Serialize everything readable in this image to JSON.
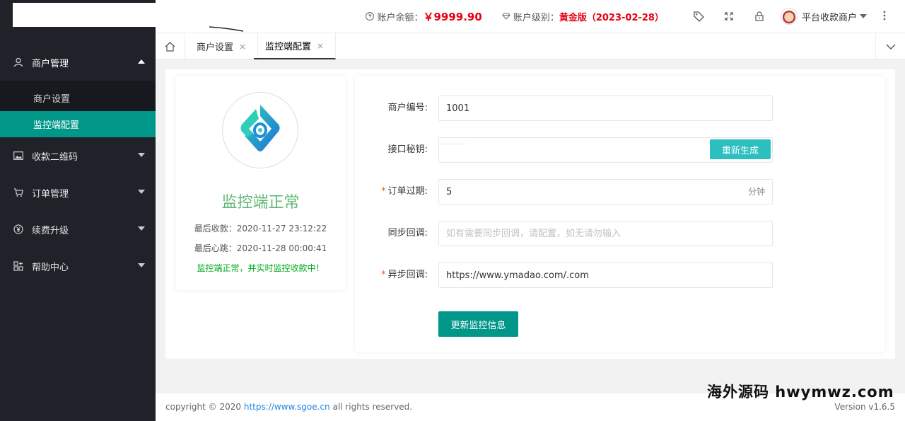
{
  "sidebar": {
    "menus": [
      {
        "label": "商户管理",
        "icon": "merchant-icon",
        "open": true,
        "children": [
          {
            "label": "商户设置"
          },
          {
            "label": "监控端配置",
            "active": true
          }
        ]
      },
      {
        "label": "收款二维码",
        "icon": "qrcode-icon"
      },
      {
        "label": "订单管理",
        "icon": "cart-icon"
      },
      {
        "label": "续费升级",
        "icon": "yen-icon"
      },
      {
        "label": "帮助中心",
        "icon": "apps-icon"
      }
    ]
  },
  "header": {
    "balance_label": "账户余额：",
    "balance_value": "￥9999.90",
    "level_label": "账户级别：",
    "level_value": "黄金版（2023-02-28）",
    "user_name": "平台收款商户"
  },
  "tabs": [
    {
      "label": "商户设置",
      "close": "×"
    },
    {
      "label": "监控端配置",
      "close": "×",
      "active": true
    }
  ],
  "status": {
    "title": "监控端正常",
    "last_payment_label": "最后收款：",
    "last_payment": "2020-11-27 23:12:22",
    "last_heartbeat_label": "最后心跳：",
    "last_heartbeat": "2020-11-28 00:00:41",
    "message": "监控端正常，并实时监控收款中！"
  },
  "form": {
    "merchant_id_label": "商户编号:",
    "merchant_id": "1001",
    "secret_label": "接口秘钥:",
    "secret_value": "",
    "regen_label": "重新生成",
    "expire_label": "订单过期:",
    "expire_value": "5",
    "expire_suffix": "分钟",
    "sync_label": "同步回调:",
    "sync_placeholder": "如有需要同步回调，请配置，如无请勿输入",
    "async_label": "异步回调:",
    "async_value": "https://www.ymadao.com/.com",
    "submit_label": "更新监控信息",
    "required_mark": "*"
  },
  "footer": {
    "copyright_prefix": "copyright © 2020",
    "link_text": "https://www.sgoe.cn",
    "copyright_suffix": "all rights reserved.",
    "version": "Version v1.6.5"
  },
  "watermark": "海外源码 hwymwz.com",
  "colors": {
    "sidebar_bg": "#20222a",
    "accent": "#009688",
    "regen_button": "#2bbfbf",
    "status_green": "#5fb878",
    "balance_red": "#e60012"
  }
}
